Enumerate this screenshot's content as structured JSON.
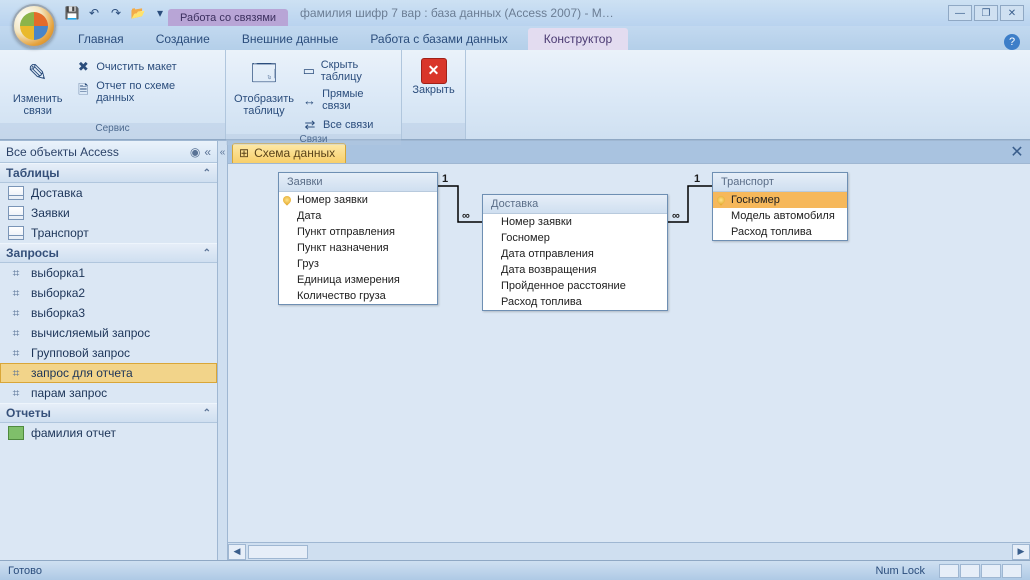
{
  "titlebar": {
    "context_label": "Работа со связями",
    "window_title": "фамилия шифр 7 вар : база данных (Access 2007) - M…"
  },
  "tabs": {
    "t0": "Главная",
    "t1": "Создание",
    "t2": "Внешние данные",
    "t3": "Работа с базами данных",
    "context": "Конструктор"
  },
  "ribbon": {
    "group1_label": "Сервис",
    "edit_relations": "Изменить связи",
    "clear_layout": "Очистить макет",
    "schema_report": "Отчет по схеме данных",
    "group2_label": "Связи",
    "show_table": "Отобразить таблицу",
    "hide_table": "Скрыть таблицу",
    "direct_relations": "Прямые связи",
    "all_relations": "Все связи",
    "close": "Закрыть"
  },
  "nav": {
    "header": "Все объекты Access",
    "section_tables": "Таблицы",
    "tables": [
      "Доставка",
      "Заявки",
      "Транспорт"
    ],
    "section_queries": "Запросы",
    "queries": [
      "выборка1",
      "выборка2",
      "выборка3",
      "вычисляемый запрос",
      "Групповой запрос",
      "запрос для отчета",
      "парам запрос"
    ],
    "selected_query_index": 5,
    "section_reports": "Отчеты",
    "reports": [
      "фамилия отчет"
    ]
  },
  "doc": {
    "tab_label": "Схема данных"
  },
  "entities": {
    "e1": {
      "title": "Заявки",
      "fields": [
        "Номер заявки",
        "Дата",
        "Пункт отправления",
        "Пункт назначения",
        "Груз",
        "Единица измерения",
        "Количество груза"
      ]
    },
    "e2": {
      "title": "Доставка",
      "fields": [
        "Номер заявки",
        "Госномер",
        "Дата отправления",
        "Дата возвращения",
        "Пройденное расстояние",
        "Расход топлива"
      ]
    },
    "e3": {
      "title": "Транспорт",
      "fields": [
        "Госномер",
        "Модель автомобиля",
        "Расход топлива"
      ]
    }
  },
  "rel_labels": {
    "one": "1",
    "many": "∞"
  },
  "status": {
    "ready": "Готово",
    "numlock": "Num Lock"
  }
}
